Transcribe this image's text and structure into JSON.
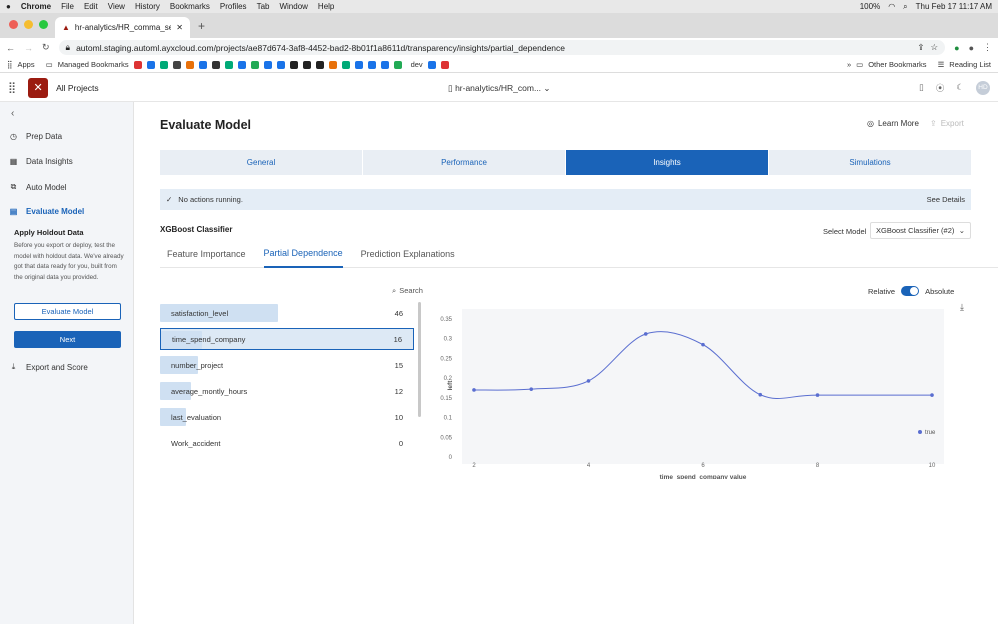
{
  "macmenu": {
    "apple": "",
    "app": "Chrome",
    "items": [
      "File",
      "Edit",
      "View",
      "History",
      "Bookmarks",
      "Profiles",
      "Tab",
      "Window",
      "Help"
    ],
    "battery": "100%",
    "datetime": "Thu Feb 17  11:17 AM"
  },
  "browser": {
    "tab_title": "hr-analytics/HR_comma_sep...",
    "url": "automl.staging.automl.ayxcloud.com/projects/ae87d674-3af8-4452-bad2-8b01f1a8611d/transparency/insights/partial_dependence",
    "bookmarks": {
      "apps": "Apps",
      "managed": "Managed Bookmarks",
      "dev": "dev",
      "other": "Other Bookmarks",
      "reading": "Reading List"
    }
  },
  "app": {
    "all_projects": "All Projects",
    "project_name": "hr-analytics/HR_com...",
    "avatar": "HD"
  },
  "sidebar": {
    "items": [
      {
        "label": "Prep Data",
        "icon": "clock-icon"
      },
      {
        "label": "Data Insights",
        "icon": "grid-icon"
      },
      {
        "label": "Auto Model",
        "icon": "layers-icon"
      },
      {
        "label": "Evaluate Model",
        "icon": "chart-icon"
      },
      {
        "label": "Export and Score",
        "icon": "download-icon"
      }
    ],
    "holdout_title": "Apply Holdout Data",
    "holdout_text": "Before you export or deploy, test the model with holdout data. We've already got that data ready for you, built from the original data you provided.",
    "evaluate_btn": "Evaluate Model",
    "next_btn": "Next"
  },
  "main": {
    "title": "Evaluate Model",
    "learn_more": "Learn More",
    "export": "Export",
    "section_tabs": [
      "General",
      "Performance",
      "Insights",
      "Simulations"
    ],
    "status": "No actions running.",
    "see_details": "See Details",
    "model_name": "XGBoost Classifier",
    "select_model_label": "Select Model",
    "select_model_value": "XGBoost Classifier (#2)",
    "insight_tabs": [
      "Feature Importance",
      "Partial Dependence",
      "Prediction Explanations"
    ],
    "search": "Search",
    "relative": "Relative",
    "absolute": "Absolute",
    "features": [
      {
        "name": "satisfaction_level",
        "value": "46",
        "frac": 0.46
      },
      {
        "name": "time_spend_company",
        "value": "16",
        "frac": 0.16
      },
      {
        "name": "number_project",
        "value": "15",
        "frac": 0.15
      },
      {
        "name": "average_montly_hours",
        "value": "12",
        "frac": 0.12
      },
      {
        "name": "last_evaluation",
        "value": "10",
        "frac": 0.1
      },
      {
        "name": "Work_accident",
        "value": "0",
        "frac": 0
      }
    ]
  },
  "chart_data": {
    "type": "line",
    "xlabel": "time_spend_company value",
    "ylabel": "left",
    "series": [
      {
        "name": "true",
        "x": [
          2,
          3,
          4,
          5,
          6,
          7,
          8,
          10
        ],
        "y": [
          0.17,
          0.172,
          0.193,
          0.312,
          0.285,
          0.158,
          0.157,
          0.157
        ]
      }
    ],
    "xticks": [
      2,
      4,
      6,
      8,
      10
    ],
    "yticks": [
      0,
      0.05,
      0.1,
      0.15,
      0.2,
      0.25,
      0.3,
      0.35
    ],
    "xlim": [
      2,
      10
    ],
    "ylim": [
      0,
      0.35
    ],
    "color": "#5a6ed0",
    "legend": "bottom-right"
  }
}
